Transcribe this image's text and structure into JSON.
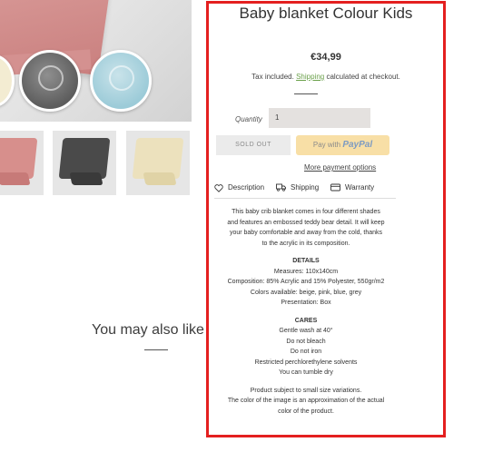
{
  "product": {
    "title": "Baby blanket Colour Kids",
    "price": "€34,99",
    "tax_prefix": "Tax included.",
    "tax_link": "Shipping",
    "tax_suffix": "calculated at checkout.",
    "quantity_label": "Quantity",
    "quantity_value": "1",
    "sold_out_label": "SOLD OUT",
    "paypal_prefix": "Pay with",
    "paypal_brand": "PayPal",
    "more_payment_label": "More payment options"
  },
  "tabs": [
    {
      "label": "Description",
      "icon": "heart-icon"
    },
    {
      "label": "Shipping",
      "icon": "truck-icon"
    },
    {
      "label": "Warranty",
      "icon": "card-icon"
    }
  ],
  "description": {
    "intro": [
      "This baby crib blanket comes in four different shades",
      "and features an embossed teddy bear detail. It will keep",
      "your baby comfortable and away from the cold, thanks",
      "to the acrylic in its composition."
    ],
    "details_heading": "DETAILS",
    "details": [
      "Measures: 110x140cm",
      "Composition: 85% Acrylic and 15% Polyester, 550gr/m2",
      "Colors available: beige, pink, blue, grey",
      "Presentation: Box"
    ],
    "cares_heading": "CARES",
    "cares": [
      "Gentle wash at 40°",
      "Do not bleach",
      "Do not iron",
      "Restricted perchlorethylene solvents",
      "You can tumble dry"
    ],
    "footer": [
      "Product subject to small size variations.",
      "The color of the image is an approximation of the actual",
      "color of the product."
    ]
  },
  "recommendations": {
    "heading": "You may also like"
  },
  "colors": {
    "highlight_border": "#e41f1f",
    "shipping_link": "#6aa04a",
    "paypal_bg": "#f8dfa6"
  }
}
